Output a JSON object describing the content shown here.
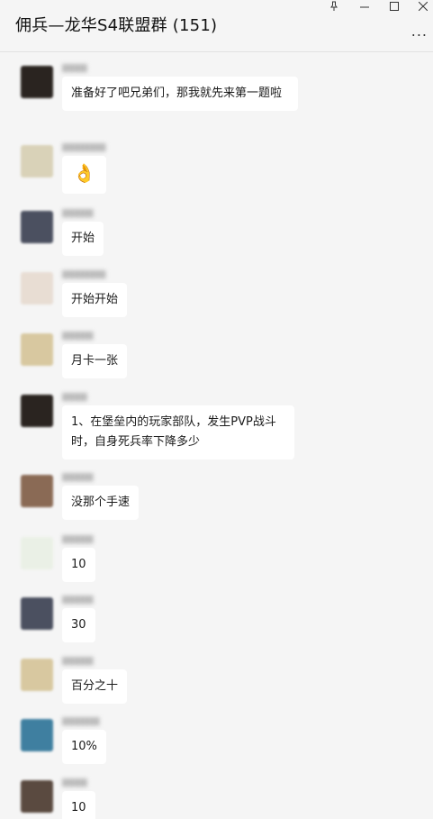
{
  "window": {
    "title": "佣兵—龙华S4联盟群 (151)",
    "pin_icon": "pin-icon",
    "minimize_icon": "minimize-icon",
    "maximize_icon": "maximize-icon",
    "close_icon": "close-icon",
    "more_icon": "more-options-icon",
    "more_symbol": "...",
    "minimize_symbol": "—",
    "maximize_symbol": "□",
    "close_symbol": "✕",
    "pin_symbol": "⊥"
  },
  "messages": [
    {
      "avatar_color": "#2a2420",
      "text": "准备好了吧兄弟们，那我就先来第一题啦"
    },
    {
      "avatar_color": "#d9d2b8",
      "text": "👌",
      "emoji": true
    },
    {
      "avatar_color": "#4b5060",
      "text": "开始"
    },
    {
      "avatar_color": "#e8ddd3",
      "text": "开始开始"
    },
    {
      "avatar_color": "#d8c8a0",
      "text": "月卡一张"
    },
    {
      "avatar_color": "#2a2420",
      "text": "1、在堡垒内的玩家部队，发生PVP战斗时，自身死兵率下降多少"
    },
    {
      "avatar_color": "#8a6a55",
      "text": "没那个手速"
    },
    {
      "avatar_color": "#eaf0e6",
      "text": "10"
    },
    {
      "avatar_color": "#4b5060",
      "text": "30"
    },
    {
      "avatar_color": "#d8c8a0",
      "text": "百分之十"
    },
    {
      "avatar_color": "#3f7fa0",
      "text": "10%"
    },
    {
      "avatar_color": "#5a4a40",
      "text": "10"
    }
  ]
}
